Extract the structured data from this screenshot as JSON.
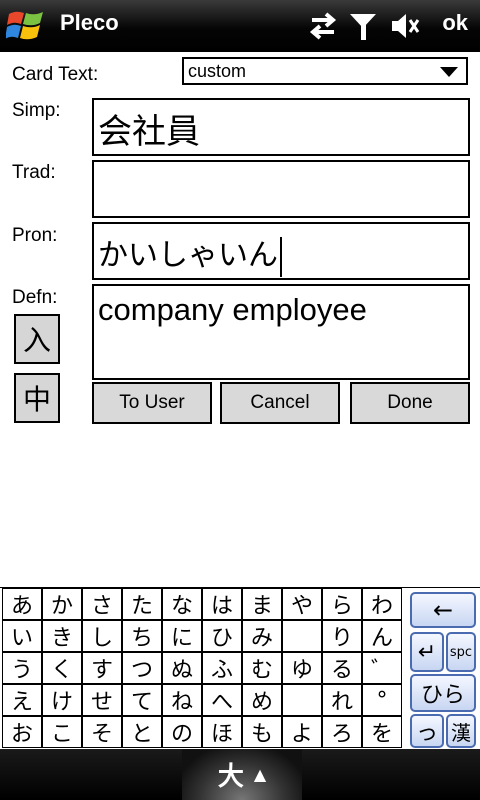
{
  "titlebar": {
    "app_title": "Pleco",
    "ok_label": "ok"
  },
  "form": {
    "card_text_label": "Card Text:",
    "card_text_value": "custom",
    "simp_label": "Simp:",
    "simp_value": "会社員",
    "trad_label": "Trad:",
    "trad_value": "",
    "pron_label": "Pron:",
    "pron_value": "かいしゃいん",
    "defn_label": "Defn:",
    "defn_value": "company employee",
    "input_btn_label": "入",
    "chinese_btn_label": "中"
  },
  "actions": {
    "to_user": "To User",
    "cancel": "Cancel",
    "done": "Done"
  },
  "keyboard": {
    "rows": [
      [
        "あ",
        "か",
        "さ",
        "た",
        "な",
        "は",
        "ま",
        "や",
        "ら",
        "わ"
      ],
      [
        "い",
        "き",
        "し",
        "ち",
        "に",
        "ひ",
        "み",
        "",
        "り",
        "ん"
      ],
      [
        "う",
        "く",
        "す",
        "つ",
        "ぬ",
        "ふ",
        "む",
        "ゆ",
        "る",
        "゛"
      ],
      [
        "え",
        "け",
        "せ",
        "て",
        "ね",
        "へ",
        "め",
        "",
        "れ",
        "°"
      ],
      [
        "お",
        "こ",
        "そ",
        "と",
        "の",
        "ほ",
        "も",
        "よ",
        "ろ",
        "を"
      ]
    ],
    "backspace": "←",
    "enter": "↵",
    "space": "spc",
    "hiragana": "ひら",
    "small_tsu": "っ",
    "kanji": "漢"
  },
  "bottombar": {
    "ime_label": "大",
    "ime_arrow": "▲"
  }
}
